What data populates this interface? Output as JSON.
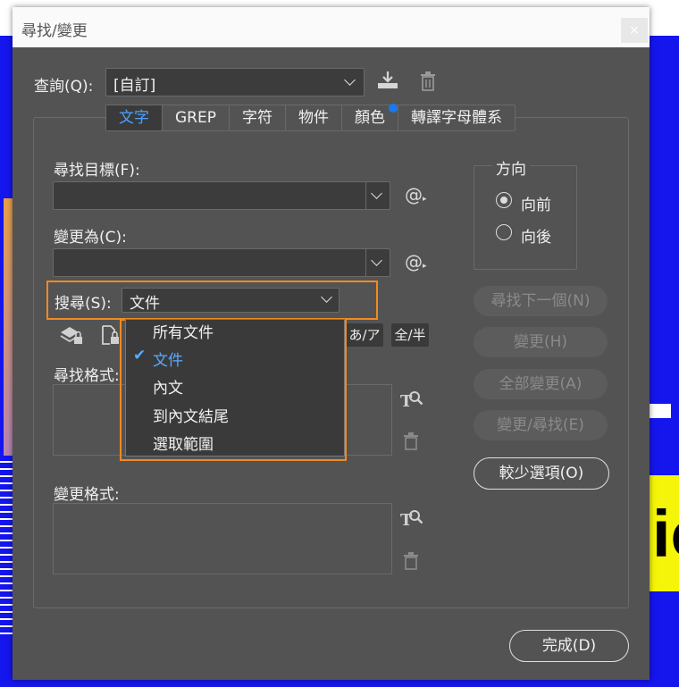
{
  "window": {
    "title": "尋找/變更",
    "close": "×"
  },
  "query": {
    "label": "查詢(Q):",
    "value": "[自訂]"
  },
  "tabs": [
    {
      "label": "文字",
      "active": true
    },
    {
      "label": "GREP"
    },
    {
      "label": "字符"
    },
    {
      "label": "物件"
    },
    {
      "label": "顏色",
      "badge": true
    },
    {
      "label": "轉譯字母體系"
    }
  ],
  "find": {
    "label": "尋找目標(F):",
    "value": ""
  },
  "change": {
    "label": "變更為(C):",
    "value": ""
  },
  "special_char": "@",
  "search": {
    "label": "搜尋(S):",
    "value": "文件",
    "options": [
      {
        "label": "所有文件"
      },
      {
        "label": "文件",
        "selected": true
      },
      {
        "label": "內文"
      },
      {
        "label": "到內文結尾"
      },
      {
        "label": "選取範圍"
      }
    ]
  },
  "kana_chip": "あ/ア",
  "width_chip": "全/半",
  "find_format": {
    "label": "尋找格式:"
  },
  "change_format": {
    "label": "變更格式:"
  },
  "direction": {
    "title": "方向",
    "forward": "向前",
    "backward": "向後",
    "selected": "forward"
  },
  "buttons": {
    "find_next": "尋找下一個(N)",
    "change": "變更(H)",
    "change_all": "全部變更(A)",
    "change_find": "變更/尋找(E)",
    "fewer_options": "較少選項(O)",
    "done": "完成(D)"
  },
  "background": {
    "big_text": "ic"
  },
  "colors": {
    "accent": "#4da2ff",
    "highlight": "#f08a22",
    "dialog_bg": "#535353"
  }
}
